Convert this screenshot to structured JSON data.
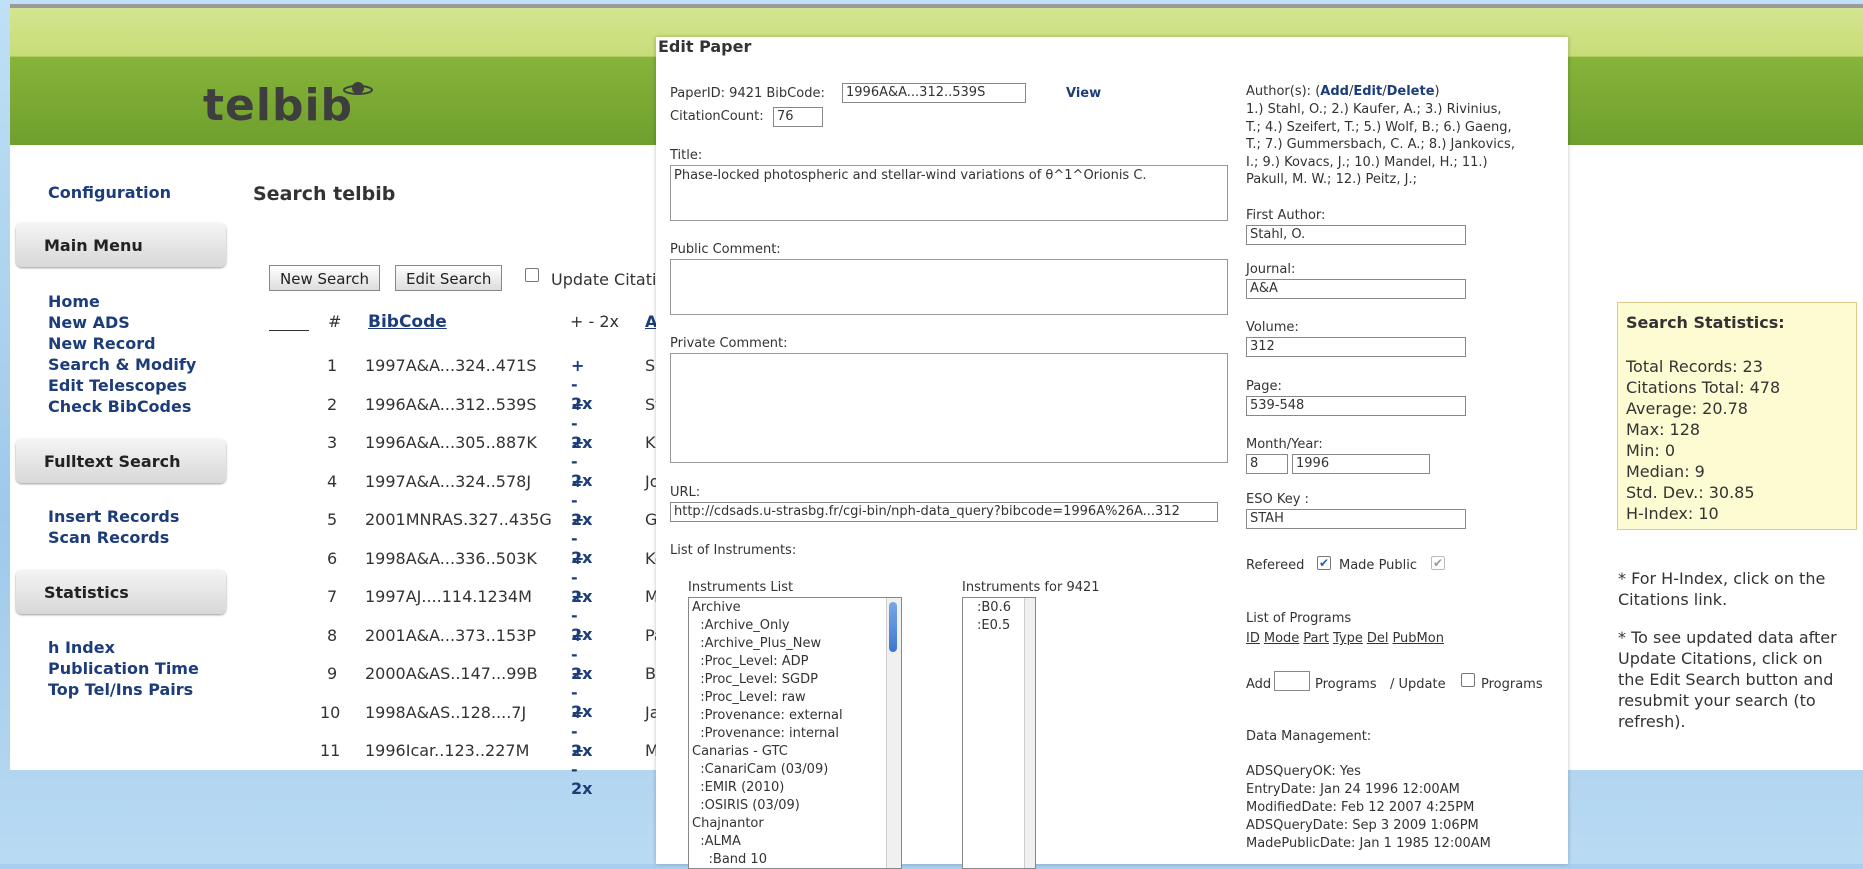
{
  "app": {
    "logo": "telbib",
    "page_title": "Search telbib"
  },
  "sidebar": {
    "config": "Configuration",
    "main_menu_head": "Main Menu",
    "main_items": [
      "Home",
      "New ADS",
      "New Record",
      "Search & Modify",
      "Edit Telescopes",
      "Check BibCodes"
    ],
    "fulltext_head": "Fulltext Search",
    "fulltext_items": [
      "Insert Records",
      "Scan Records"
    ],
    "stats_head": "Statistics",
    "stats_items": [
      "h Index",
      "Publication Time",
      "Top Tel/Ins Pairs"
    ]
  },
  "toolbar": {
    "new_search": "New Search",
    "edit_search": "Edit Search",
    "update_citations": "Update Citati"
  },
  "table": {
    "headers": {
      "num": "#",
      "bibcode": "BibCode",
      "pm": "+ - 2x",
      "author": "A"
    },
    "rows": [
      {
        "n": "1",
        "bib": "1997A&A...324..471S",
        "a": "Sa"
      },
      {
        "n": "2",
        "bib": "1996A&A...312..539S",
        "a": "St"
      },
      {
        "n": "3",
        "bib": "1996A&A...305..887K",
        "a": "Ka"
      },
      {
        "n": "4",
        "bib": "1997A&A...324..578J",
        "a": "Jo"
      },
      {
        "n": "5",
        "bib": "2001MNRAS.327..435G",
        "a": "Gu"
      },
      {
        "n": "6",
        "bib": "1998A&A...336..503K",
        "a": "Ko"
      },
      {
        "n": "7",
        "bib": "1997AJ....114.1234M",
        "a": "Mi"
      },
      {
        "n": "8",
        "bib": "2001A&A...373..153P",
        "a": "Pa"
      },
      {
        "n": "9",
        "bib": "2000A&AS..147...99B",
        "a": "Ba"
      },
      {
        "n": "10",
        "bib": "1998A&AS..128....7J",
        "a": "Ja"
      },
      {
        "n": "11",
        "bib": "1996Icar..123..227M",
        "a": "Ma"
      }
    ],
    "pm_label": "+ - 2x"
  },
  "stats": {
    "title": "Search Statistics:",
    "lines": [
      "Total Records: 23",
      "Citations Total: 478",
      "Average: 20.78",
      "Max: 128",
      "Min: 0",
      "Median: 9",
      "Std. Dev.: 30.85",
      "H-Index: 10"
    ]
  },
  "notes": {
    "hindex": "* For H-Index, click on the Citations link.",
    "update": "* To see updated data after Update Citations, click on the Edit Search button and resubmit your search (to refresh)."
  },
  "modal": {
    "title": "Edit Paper",
    "paperid_label": "PaperID: 9421 BibCode:",
    "bibcode": "1996A&A...312..539S",
    "view": "View",
    "citation_label": "CitationCount:",
    "citation_count": "76",
    "title_label": "Title:",
    "title_value": "Phase-locked photospheric and stellar-wind variations of θ^1^Orionis C.",
    "public_comment": "Public Comment:",
    "private_comment": "Private Comment:",
    "url_label": "URL:",
    "url_value": "http://cdsads.u-strasbg.fr/cgi-bin/nph-data_query?bibcode=1996A%26A...312",
    "instruments_label": "List of Instruments:",
    "inst_list_label": "Instruments List",
    "inst_for_label": "Instruments for 9421",
    "inst_list": [
      "Archive",
      "  :Archive_Only",
      "  :Archive_Plus_New",
      "  :Proc_Level: ADP",
      "  :Proc_Level: SGDP",
      "  :Proc_Level: raw",
      "  :Provenance: external",
      "  :Provenance: internal",
      "Canarias - GTC",
      "  :CanariCam (03/09)",
      "  :EMIR (2010)",
      "  :OSIRIS (03/09)",
      "Chajnantor",
      "  :ALMA",
      "    :Band 10"
    ],
    "inst_selected": [
      ":B0.6",
      ":E0.5"
    ],
    "authors_label": "Author(s): (",
    "authors_add": "Add",
    "authors_edit": "Edit",
    "authors_delete": "Delete",
    "authors_lines": [
      "1.) Stahl, O.; 2.) Kaufer, A.; 3.) Rivinius,",
      "T.; 4.) Szeifert, T.; 5.) Wolf, B.; 6.) Gaeng,",
      "T.; 7.) Gummersbach, C. A.; 8.) Jankovics,",
      "I.; 9.) Kovacs, J.; 10.) Mandel, H.; 11.)",
      "Pakull, M. W.; 12.) Peitz, J.;"
    ],
    "first_author_label": "First Author:",
    "first_author": "Stahl, O.",
    "journal_label": "Journal:",
    "journal": "A&A",
    "volume_label": "Volume:",
    "volume": "312",
    "page_label": "Page:",
    "page": "539-548",
    "monthyear_label": "Month/Year:",
    "month": "8",
    "year": "1996",
    "eso_label": "ESO Key :",
    "eso": "STAH",
    "refereed": "Refereed",
    "made_public": "Made Public",
    "programs_label": "List of Programs",
    "programs_cols": [
      "ID",
      "Mode",
      "Part",
      "Type",
      "Del",
      "PubMon"
    ],
    "add_label": "Add",
    "programs_word": "Programs",
    "update_label": "/ Update",
    "programs_word2": "Programs",
    "data_mgmt": "Data Management:",
    "dm_lines": [
      "ADSQueryOK: Yes",
      "EntryDate: Jan 24 1996 12:00AM",
      "ModifiedDate: Feb 12 2007 4:25PM",
      "ADSQueryDate: Sep 3 2009 1:06PM",
      "MadePublicDate: Jan 1 1985 12:00AM"
    ]
  }
}
